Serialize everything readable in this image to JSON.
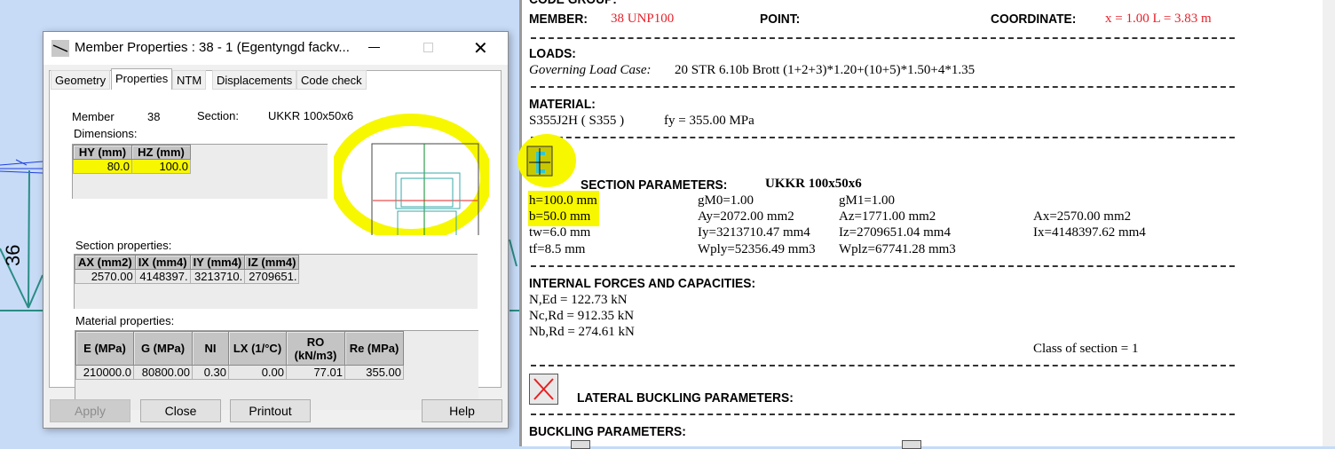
{
  "dialog": {
    "title": "Member Properties : 38 - 1 (Egentyngd fackv...",
    "tabs": [
      "Geometry",
      "Properties",
      "NTM",
      "Displacements",
      "Code check"
    ],
    "active_tab": "Properties",
    "member_label": "Member",
    "member_value": "38",
    "section_label": "Section:",
    "section_value": "UKKR 100x50x6",
    "dimensions_label": "Dimensions:",
    "dimensions": {
      "headers": [
        "HY (mm)",
        "HZ (mm)"
      ],
      "values": [
        "80.0",
        "100.0"
      ]
    },
    "section_properties_label": "Section properties:",
    "section_properties": {
      "headers": [
        "AX (mm2)",
        "IX (mm4)",
        "IY (mm4)",
        "IZ (mm4)"
      ],
      "values": [
        "2570.00",
        "4148397.",
        "3213710.",
        "2709651."
      ]
    },
    "material_properties_label": "Material properties:",
    "material_properties": {
      "headers": [
        "E (MPa)",
        "G (MPa)",
        "NI",
        "LX (1/°C)",
        "RO (kN/m3)",
        "Re (MPa)"
      ],
      "values": [
        "210000.0",
        "80800.00",
        "0.30",
        "0.00",
        "77.01",
        "355.00"
      ]
    },
    "buttons": {
      "apply": "Apply",
      "close": "Close",
      "printout": "Printout",
      "help": "Help"
    }
  },
  "background": {
    "bar_labels": [
      "36"
    ]
  },
  "report": {
    "code_group": "CODE GROUP:",
    "member_label": "MEMBER:",
    "member_value": "38  UNP100",
    "point_label": "POINT:",
    "coordinate_label": "COORDINATE:",
    "coordinate_value": "x = 1.00 L = 3.83 m",
    "loads_label": "LOADS:",
    "governing_label": "Governing Load Case:",
    "governing_value": "20 STR 6.10b Brott  (1+2+3)*1.20+(10+5)*1.50+4*1.35",
    "material_label": "MATERIAL:",
    "material_value": "S355J2H  ( S355 )",
    "fy": "fy = 355.00 MPa",
    "section_label": "SECTION PARAMETERS:",
    "section_value": "UKKR 100x50x6",
    "section_params": [
      [
        "h=100.0 mm",
        "gM0=1.00",
        "gM1=1.00",
        ""
      ],
      [
        "b=50.0 mm",
        "Ay=2072.00 mm2",
        "Az=1771.00 mm2",
        "Ax=2570.00 mm2"
      ],
      [
        "tw=6.0 mm",
        "Iy=3213710.47 mm4",
        "Iz=2709651.04 mm4",
        "Ix=4148397.62 mm4"
      ],
      [
        "tf=8.5 mm",
        "Wply=52356.49 mm3",
        "Wplz=67741.28 mm3",
        ""
      ]
    ],
    "internal_label": "INTERNAL FORCES AND CAPACITIES:",
    "forces": [
      "N,Ed = 122.73 kN",
      "Nc,Rd = 912.35 kN",
      "Nb,Rd = 274.61 kN"
    ],
    "class_of_section": "Class of section = 1",
    "lateral_label": "LATERAL BUCKLING PARAMETERS:",
    "buckling_label": "BUCKLING PARAMETERS:"
  },
  "colors": {
    "highlight": "#f7f700",
    "red": "#e8202a",
    "viewport": "#c7dbf7"
  }
}
